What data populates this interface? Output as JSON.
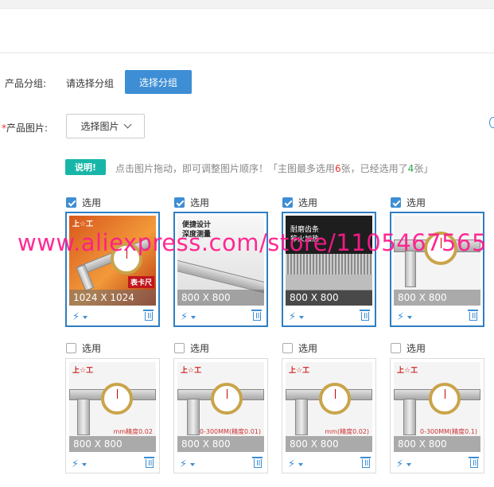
{
  "form": {
    "group_label": "产品分组:",
    "group_value": "请选择分组",
    "group_button": "选择分组",
    "image_required_mark": "*",
    "image_label": "产品图片:",
    "image_button": "选择图片"
  },
  "note": {
    "badge": "说明!",
    "text_a": "点击图片拖动，即可调整图片顺序！「主图最多选用",
    "max_count": "6",
    "text_b": "张，已经选用了",
    "selected_count": "4",
    "text_c": "张」"
  },
  "select_label": "选用",
  "images": [
    {
      "checked": true,
      "size": "1024 X 1024",
      "overlay": [
        "上☆工",
        "表卡尺"
      ]
    },
    {
      "checked": true,
      "size": "800 X 800",
      "overlay": [
        "便捷设计",
        "深度测量"
      ]
    },
    {
      "checked": true,
      "size": "800 X 800",
      "overlay": [
        "耐磨齿条",
        "猝火加热"
      ]
    },
    {
      "checked": true,
      "size": "800 X 800",
      "overlay": []
    },
    {
      "checked": false,
      "size": "800 X 800",
      "overlay": [
        "上☆工",
        "mm精度0.02"
      ]
    },
    {
      "checked": false,
      "size": "800 X 800",
      "overlay": [
        "上☆工",
        "0-300MM(精度0.01)"
      ]
    },
    {
      "checked": false,
      "size": "800 X 800",
      "overlay": [
        "上☆工",
        "mm(精度0.02)"
      ]
    },
    {
      "checked": false,
      "size": "800 X 800",
      "overlay": [
        "上☆工",
        "0-300MM(精度0.1)"
      ]
    }
  ],
  "watermark": "www.aliexpress.com/store/1105467565",
  "colors": {
    "primary": "#3d8ed4",
    "badge": "#17b6a8",
    "required": "#ee3333",
    "watermark": "#ff1a8c"
  }
}
